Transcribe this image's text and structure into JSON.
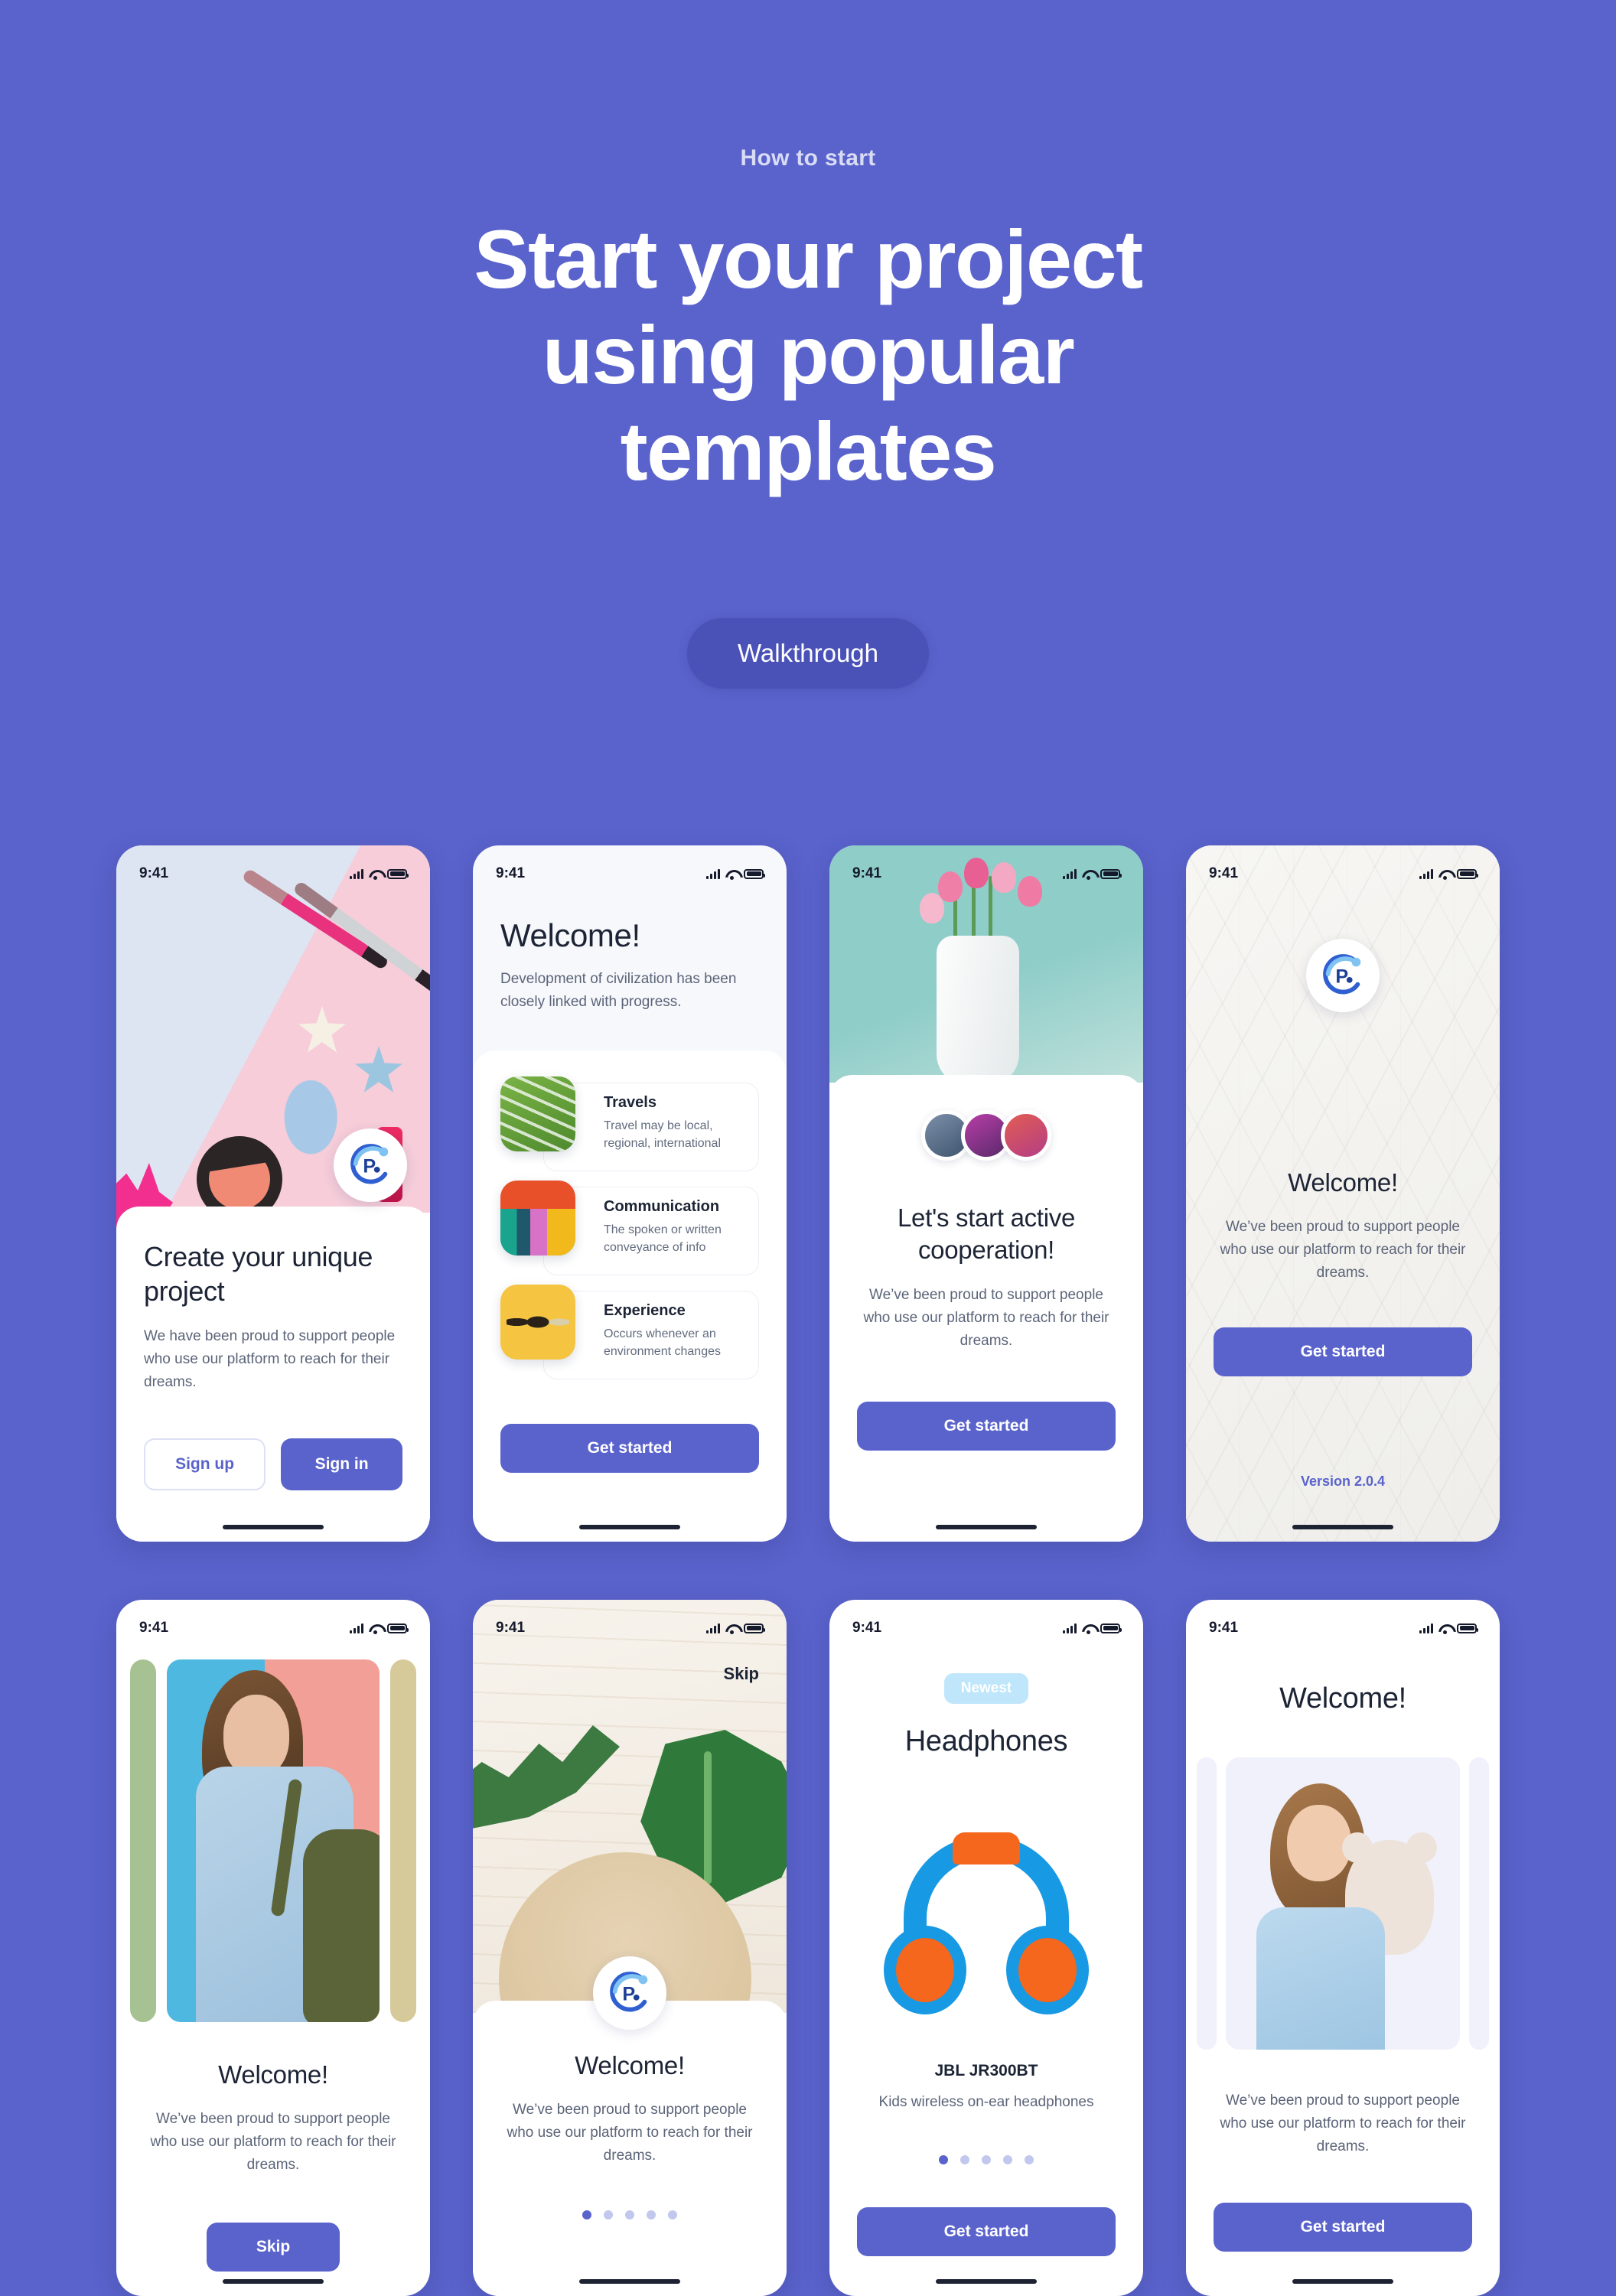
{
  "theme": {
    "bg": "#5a63cc",
    "accent": "#5a63cc",
    "walkthrough_bg": "#4a52b8",
    "badge_bg": "#bfe6fb"
  },
  "hero": {
    "eyebrow": "How to start",
    "title_line1": "Start your project",
    "title_line2": "using popular",
    "title_line3": "templates",
    "cta": "Walkthrough"
  },
  "status_bar": {
    "time": "9:41"
  },
  "cards": [
    {
      "id": "create-unique-project",
      "title": "Create your unique project",
      "body": "We have been proud to support people who use our platform to reach for their dreams.",
      "buttons": [
        "Sign up",
        "Sign in"
      ]
    },
    {
      "id": "welcome-feature-list",
      "title": "Welcome!",
      "body": "Development of civilization has been closely linked with progress.",
      "items": [
        {
          "title": "Travels",
          "desc": "Travel may be local, regional, international"
        },
        {
          "title": "Communication",
          "desc": "The spoken or written conveyance of info"
        },
        {
          "title": "Experience",
          "desc": "Occurs whenever an environment changes"
        }
      ],
      "button": "Get started"
    },
    {
      "id": "active-cooperation",
      "title": "Let's start active cooperation!",
      "body": "We’ve been proud to support people who use our platform to reach for their dreams.",
      "button": "Get started"
    },
    {
      "id": "welcome-version",
      "title": "Welcome!",
      "body": "We’ve been proud to support people who use our platform to reach for their dreams.",
      "button": "Get started",
      "version": "Version 2.0.4"
    },
    {
      "id": "welcome-skip",
      "title": "Welcome!",
      "body": "We’ve been proud to support people who use our platform to reach for their dreams.",
      "button": "Skip"
    },
    {
      "id": "welcome-carousel",
      "skip": "Skip",
      "title": "Welcome!",
      "body": "We’ve been proud to support people who use our platform to reach for their dreams.",
      "dots": {
        "count": 5,
        "active": 1
      }
    },
    {
      "id": "headphones-product",
      "badge": "Newest",
      "title": "Headphones",
      "product_name": "JBL JR300BT",
      "product_desc": "Kids wireless on-ear headphones",
      "dots": {
        "count": 5,
        "active": 1
      },
      "button": "Get started"
    },
    {
      "id": "welcome-kid",
      "title": "Welcome!",
      "body": "We’ve been proud to support people who use our platform to reach for their dreams.",
      "button": "Get started"
    }
  ]
}
